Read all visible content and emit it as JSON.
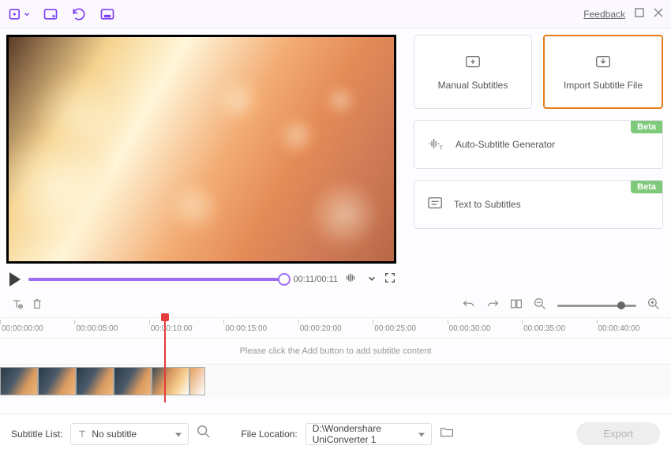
{
  "topbar": {
    "feedback": "Feedback"
  },
  "cards": {
    "manual": "Manual Subtitles",
    "import": "Import Subtitle File",
    "auto": "Auto-Subtitle Generator",
    "text": "Text to Subtitles",
    "beta": "Beta"
  },
  "player": {
    "time": "00:11/00:11"
  },
  "timeline": {
    "ticks": [
      "00:00:00:00",
      "00:00:05:00",
      "00:00:10:00",
      "00:00:15:00",
      "00:00:20:00",
      "00:00:25:00",
      "00:00:30:00",
      "00:00:35:00",
      "00:00:40:00"
    ],
    "placeholder": "Please click the Add button to add subtitle content"
  },
  "bottom": {
    "subtitle_list_label": "Subtitle List:",
    "subtitle_value": "No subtitle",
    "file_location_label": "File Location:",
    "file_location_value": "D:\\Wondershare UniConverter 1",
    "export": "Export"
  }
}
